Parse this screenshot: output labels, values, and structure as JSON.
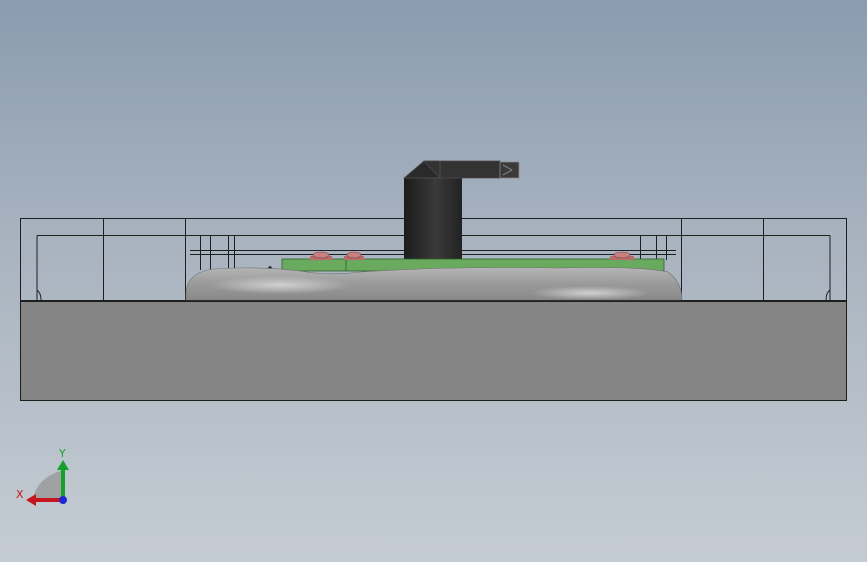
{
  "viewport": {
    "background_top": "#8b9cb0",
    "background_bottom": "#c5ccd3"
  },
  "model": {
    "base_color": "#858585",
    "outline_color": "#1e1e1e",
    "body_color": "#9b9b9b",
    "pcb_color": "#6aaa5e",
    "component_color": "#b86b6b",
    "knob_color": "#2e2e2e"
  },
  "triad": {
    "x_label": "X",
    "y_label": "Y",
    "x_color": "#c8141e",
    "y_color": "#16a02a",
    "z_color": "#1e28d2"
  }
}
